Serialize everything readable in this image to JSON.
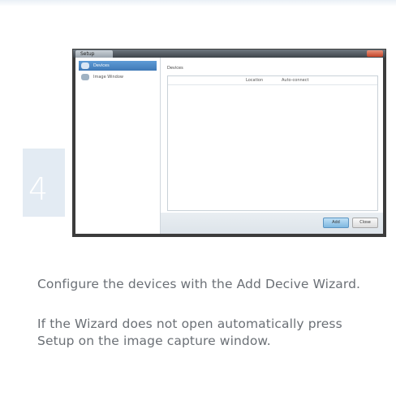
{
  "step": {
    "number": "4"
  },
  "dialog": {
    "title": "Setup",
    "sidebar_items": [
      {
        "label": "Devices",
        "selected": true
      },
      {
        "label": "Image Window",
        "selected": false
      }
    ],
    "devices_label": "Devices",
    "columns": [
      "Location",
      "Auto-connect"
    ],
    "add_button": "Add",
    "close_button": "Close"
  },
  "instructions": {
    "paragraph1": "Configure the devices with the Add Decive Wizard.",
    "paragraph2": "If the Wizard does not open automatically press Setup on the image capture window."
  }
}
